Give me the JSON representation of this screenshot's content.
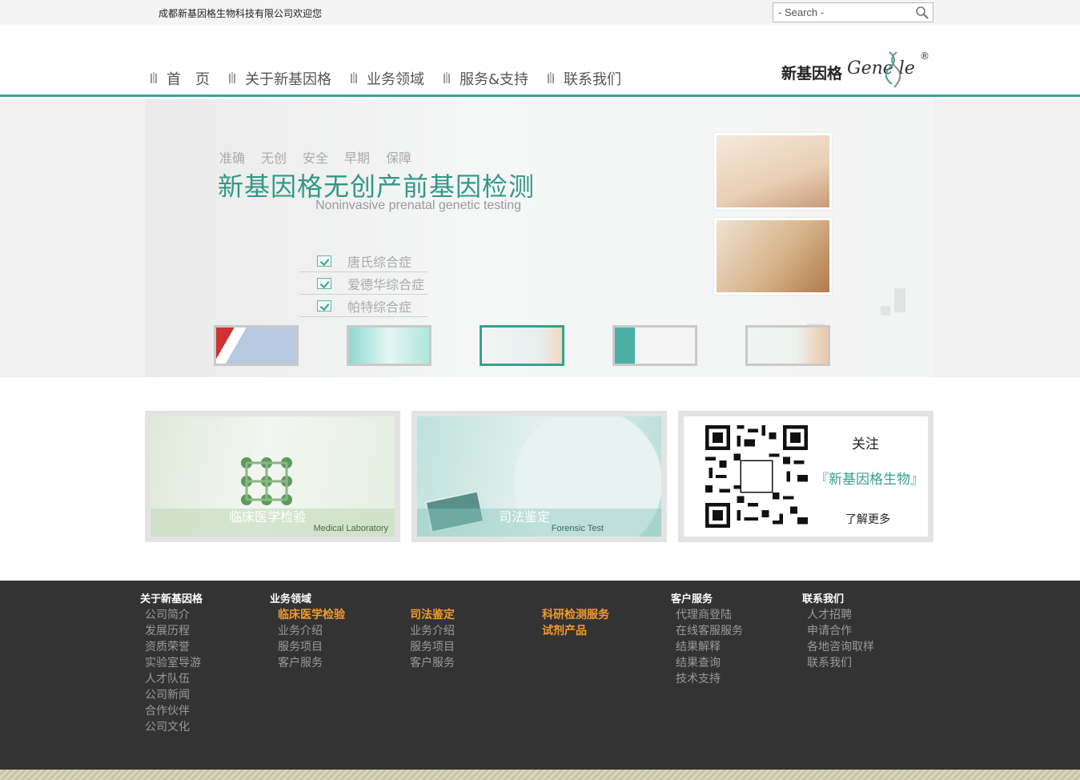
{
  "topbar": {
    "welcome": "成都新基因格生物科技有限公司欢迎您",
    "search_placeholder": "- Search -"
  },
  "nav": {
    "items": [
      "首　页",
      "关于新基因格",
      "业务领域",
      "服务&支持",
      "联系我们"
    ]
  },
  "logo": {
    "cn": "新基因格",
    "en": "Gene le",
    "reg": "®"
  },
  "banner": {
    "tags": [
      "准确",
      "无创",
      "安全",
      "早期",
      "保障"
    ],
    "title": "新基因格无创产前基因检测",
    "subtitle": "Noninvasive prenatal genetic testing",
    "checks": [
      "唐氏综合症",
      "爱德华综合症",
      "帕特综合症"
    ],
    "active_thumb": 3
  },
  "cards": [
    {
      "cn": "临床医学检验",
      "en": "Medical Laboratory"
    },
    {
      "cn": "司法鉴定",
      "en": "Forensic Test"
    }
  ],
  "qr_card": {
    "follow": "关注",
    "brand": "『新基因格生物』",
    "more": "了解更多"
  },
  "footer": {
    "col1": {
      "title": "关于新基因格",
      "links": [
        "公司简介",
        "发展历程",
        "资质荣誉",
        "实验室导游",
        "人才队伍",
        "公司新闻",
        "合作伙伴",
        "公司文化"
      ]
    },
    "col2": {
      "title": "业务领域",
      "head": "临床医学检验",
      "links": [
        "业务介绍",
        "服务项目",
        "客户服务"
      ]
    },
    "col3": {
      "head": "司法鉴定",
      "links": [
        "业务介绍",
        "服务项目",
        "客户服务"
      ]
    },
    "col4": {
      "head1": "科研检测服务",
      "head2": "试剂产品"
    },
    "col5": {
      "title": "客户服务",
      "links": [
        "代理商登陆",
        "在线客服服务",
        "结果解释",
        "结果查询",
        "技术支持"
      ]
    },
    "col6": {
      "title": "联系我们",
      "links": [
        "人才招聘",
        "申请合作",
        "各地咨询取样",
        "联系我们"
      ]
    }
  },
  "colors": {
    "accent": "#3aa08e",
    "footer_bg": "#333333",
    "highlight": "#f29b2c"
  }
}
